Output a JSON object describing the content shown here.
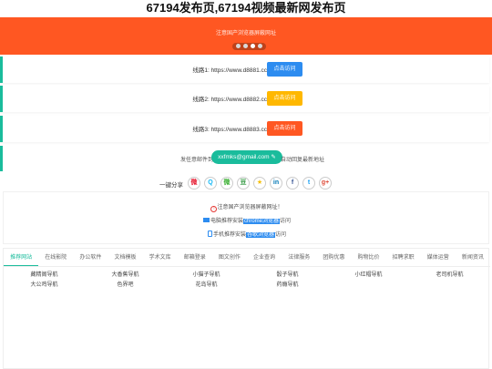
{
  "page_title": "67194发布页,67194视频最新网发布页",
  "banner": {
    "text": "注意国产浏览器屏蔽网址",
    "color": "#ff5722",
    "dots": [
      false,
      false,
      true,
      false
    ]
  },
  "lines": [
    {
      "label": "线路1:  https://www.d8881.cc",
      "button": "点击访问",
      "button_color": "#2d8cf0"
    },
    {
      "label": "线路2:  https://www.d8882.cc",
      "button": "点击访问",
      "button_color": "#ffb800"
    },
    {
      "label": "线路3:  https://www.d8883.cc",
      "button": "点击访问",
      "button_color": "#ff5722"
    }
  ],
  "email": {
    "left_text": "发任意邮件到",
    "address": "xxfmks@gmail.com",
    "right_text": "自动回复最新地址"
  },
  "share": {
    "label": "一键分享",
    "icons": [
      {
        "name": "weibo-icon",
        "glyph": "微",
        "color": "#e6162d"
      },
      {
        "name": "qq-icon",
        "glyph": "Q",
        "color": "#12b7f5"
      },
      {
        "name": "wechat-icon",
        "glyph": "微",
        "color": "#3cb034"
      },
      {
        "name": "douban-icon",
        "glyph": "豆",
        "color": "#2e963d"
      },
      {
        "name": "qzone-icon",
        "glyph": "★",
        "color": "#f5be00"
      },
      {
        "name": "linkedin-icon",
        "glyph": "in",
        "color": "#0077b5"
      },
      {
        "name": "facebook-icon",
        "glyph": "f",
        "color": "#3b5998"
      },
      {
        "name": "twitter-icon",
        "glyph": "t",
        "color": "#1da1f2"
      },
      {
        "name": "google-plus-icon",
        "glyph": "g+",
        "color": "#dd4b39"
      }
    ]
  },
  "notice": {
    "line1": "注意国产浏览器屏蔽网址！",
    "line2_pre": "电脑推荐安装",
    "line2_hl": "chrome浏览器",
    "line2_post": "访问",
    "line3_pre": "手机推荐安装",
    "line3_hl": "谷歌浏览器",
    "line3_post": "访问"
  },
  "tabs": [
    "推荐网站",
    "在线影院",
    "办公软件",
    "文档模板",
    "学术文库",
    "邮箱登录",
    "图文创作",
    "企业查询",
    "法律服务",
    "团购优惠",
    "购物比价",
    "招聘求职",
    "媒体运营",
    "新闻资讯"
  ],
  "active_tab": 0,
  "links": [
    "藏精阁导航",
    "大香蕉导航",
    "小猫子导航",
    "骰子导航",
    "小红帽导航",
    "老司机导航",
    "大公鸡导航",
    "色界吧",
    "花岛导航",
    "药瘾导航"
  ]
}
